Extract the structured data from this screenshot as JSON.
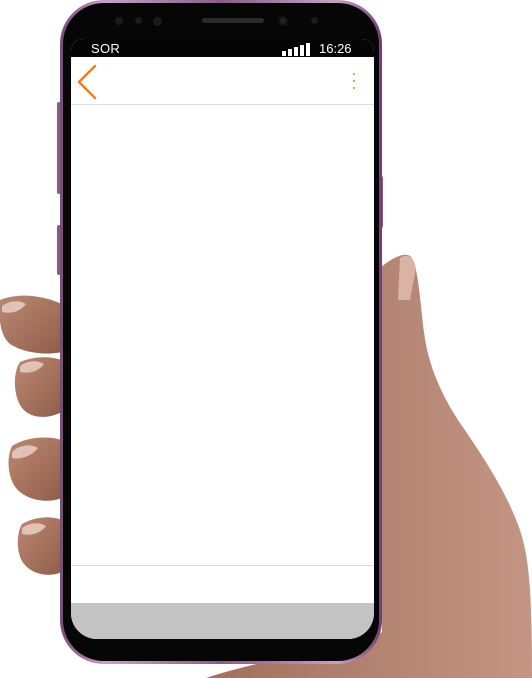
{
  "status_bar": {
    "carrier": "SOR",
    "time": "16:26"
  },
  "header": {
    "back_icon": "chevron-left-icon",
    "menu_icon": "more-vertical-icon"
  },
  "colors": {
    "accent": "#ef7d1a",
    "status_bar_background": "#050505",
    "bottom_bar": "#c3c3c3",
    "divider": "#dcdcdc",
    "phone_frame": "#8c5b89"
  }
}
